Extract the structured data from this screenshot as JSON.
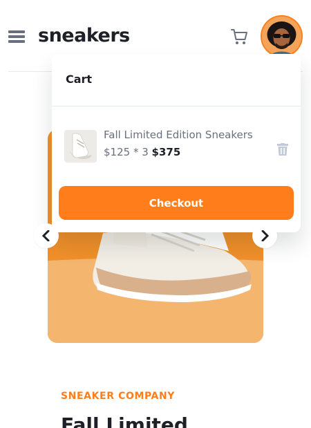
{
  "header": {
    "logo": "sneakers",
    "menu_icon": "hamburger-menu-icon",
    "cart_icon": "shopping-cart-icon"
  },
  "cart": {
    "title": "Cart",
    "item": {
      "name": "Fall Limited Edition Sneakers",
      "calc": "$125 * 3",
      "total": "$375"
    },
    "delete_icon": "trash-icon",
    "checkout_label": "Checkout"
  },
  "product": {
    "company": "SNEAKER COMPANY",
    "title": "Fall Limited"
  },
  "gallery": {
    "prev_icon": "chevron-left-icon",
    "next_icon": "chevron-right-icon"
  },
  "colors": {
    "accent": "#ff7e1b",
    "text_dark": "#1d2026",
    "text_muted": "#69707d",
    "image_background": "#f0902a"
  }
}
